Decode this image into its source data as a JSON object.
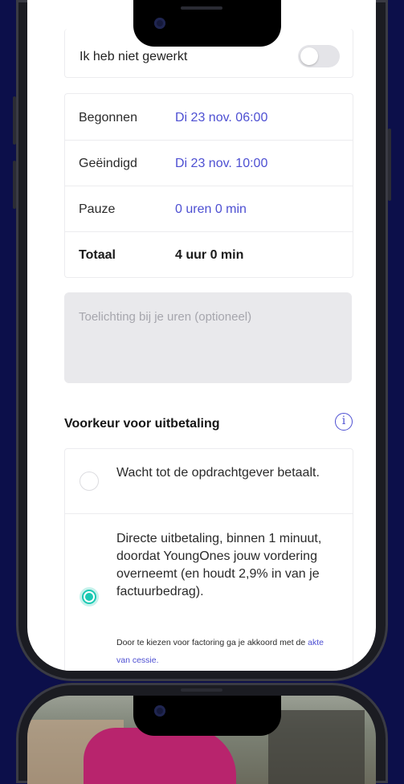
{
  "worked_toggle": {
    "label": "Ik heb niet gewerkt",
    "on": false
  },
  "times": {
    "rows": [
      {
        "label": "Begonnen",
        "value": "Di 23 nov. 06:00"
      },
      {
        "label": "Geëindigd",
        "value": "Di 23 nov. 10:00"
      },
      {
        "label": "Pauze",
        "value": "0 uren 0 min"
      },
      {
        "label": "Totaal",
        "value": "4 uur 0 min"
      }
    ]
  },
  "comment": {
    "placeholder": "Toelichting bij je uren (optioneel)"
  },
  "payout": {
    "title": "Voorkeur voor uitbetaling",
    "info_icon": "info-icon",
    "options": [
      {
        "label": "Wacht tot de opdrachtgever betaalt.",
        "selected": false
      },
      {
        "label": "Directe uitbetaling, binnen 1 minuut, doordat YoungOnes jouw vordering overneemt (en houdt 2,9% in van je factuurbedrag).",
        "selected": true,
        "fine_print": "Door te kiezen voor factoring ga je akkoord met de",
        "fine_link": "akte van cessie."
      }
    ]
  },
  "colors": {
    "accent": "#4d4fd2",
    "radio_selected": "#1cc9b3",
    "background": "#0c0f4a"
  }
}
